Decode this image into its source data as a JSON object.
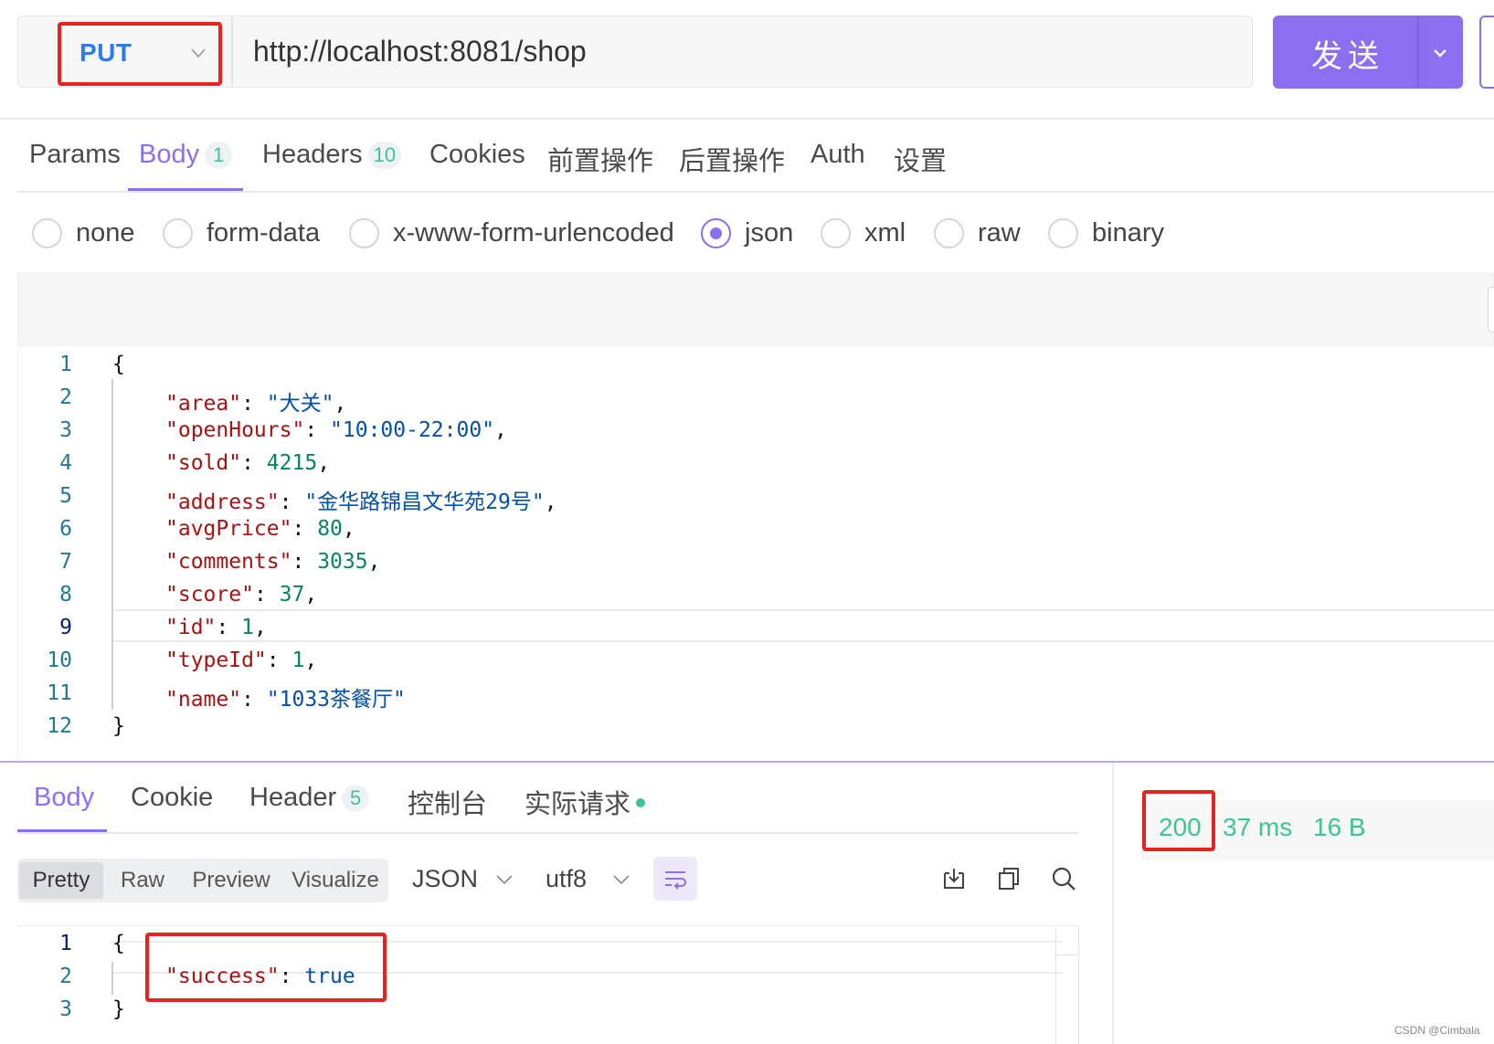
{
  "request": {
    "method": "PUT",
    "url": "http://localhost:8081/shop",
    "send_label": "发送"
  },
  "request_tabs": [
    {
      "label": "Params",
      "badge": ""
    },
    {
      "label": "Body",
      "badge": "1"
    },
    {
      "label": "Headers",
      "badge": "10"
    },
    {
      "label": "Cookies",
      "badge": ""
    },
    {
      "label": "前置操作",
      "badge": ""
    },
    {
      "label": "后置操作",
      "badge": ""
    },
    {
      "label": "Auth",
      "badge": ""
    },
    {
      "label": "设置",
      "badge": ""
    }
  ],
  "body_types": [
    "none",
    "form-data",
    "x-www-form-urlencoded",
    "json",
    "xml",
    "raw",
    "binary"
  ],
  "selected_body_type": "json",
  "request_body_lines": [
    {
      "num": "1",
      "key": "",
      "value": "",
      "text": "{"
    },
    {
      "num": "2",
      "key": "\"area\"",
      "value": "\"大关\"",
      "kind": "s",
      "comma": ","
    },
    {
      "num": "3",
      "key": "\"openHours\"",
      "value": "\"10:00-22:00\"",
      "kind": "s",
      "comma": ","
    },
    {
      "num": "4",
      "key": "\"sold\"",
      "value": "4215",
      "kind": "n",
      "comma": ","
    },
    {
      "num": "5",
      "key": "\"address\"",
      "value": "\"金华路锦昌文华苑29号\"",
      "kind": "s",
      "comma": ","
    },
    {
      "num": "6",
      "key": "\"avgPrice\"",
      "value": "80",
      "kind": "n",
      "comma": ","
    },
    {
      "num": "7",
      "key": "\"comments\"",
      "value": "3035",
      "kind": "n",
      "comma": ","
    },
    {
      "num": "8",
      "key": "\"score\"",
      "value": "37",
      "kind": "n",
      "comma": ","
    },
    {
      "num": "9",
      "key": "\"id\"",
      "value": "1",
      "kind": "n",
      "comma": ","
    },
    {
      "num": "10",
      "key": "\"typeId\"",
      "value": "1",
      "kind": "n",
      "comma": ","
    },
    {
      "num": "11",
      "key": "\"name\"",
      "value": "\"1033茶餐厅\"",
      "kind": "s",
      "comma": ""
    },
    {
      "num": "12",
      "key": "",
      "value": "",
      "text": "}"
    }
  ],
  "response_tabs": [
    {
      "label": "Body",
      "badge": ""
    },
    {
      "label": "Cookie",
      "badge": ""
    },
    {
      "label": "Header",
      "badge": "5"
    },
    {
      "label": "控制台",
      "badge": ""
    },
    {
      "label": "实际请求",
      "badge": ""
    }
  ],
  "view_modes": [
    "Pretty",
    "Raw",
    "Preview",
    "Visualize"
  ],
  "format": "JSON",
  "encoding": "utf8",
  "response_body_lines": [
    {
      "num": "1",
      "text": "{"
    },
    {
      "num": "2",
      "key": "\"success\"",
      "value": "true"
    },
    {
      "num": "3",
      "text": "}"
    }
  ],
  "status": {
    "code": "200",
    "time": "37 ms",
    "size": "16 B"
  },
  "watermark": "CSDN @Cimbala",
  "colors": {
    "accent": "#8b6ff0",
    "success": "#3ec48e",
    "method": "#2f7af0",
    "highlight_box": "#e8231f"
  }
}
